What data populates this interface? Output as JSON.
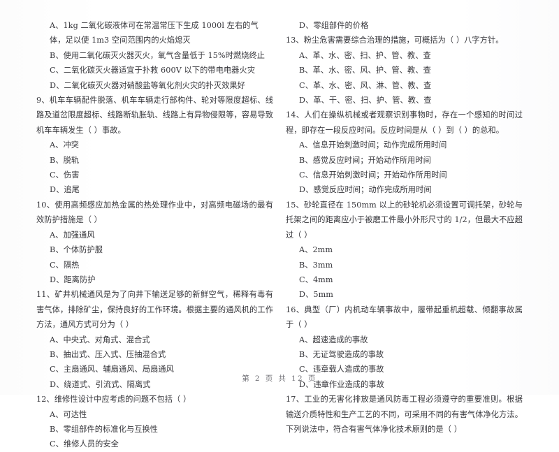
{
  "document": {
    "type": "scanned-exam-paper",
    "page_footer": "第 2 页 共 12 页",
    "ink_color": "#35353a",
    "paper_color": "#ffffff"
  },
  "left_column": {
    "continued_options": [
      "A、1kg 二氧化碳液体可在常温常压下生成 1000l 左右的气体，足以使 1m3 空间范围内的火焰熄灭",
      "B、使用二氧化碳灭火器灭火，氧气含量低于 15%时燃烧终止",
      "C、二氧化碳灭火器适宜于扑救 600V 以下的带电电器火灾",
      "D、二氧化碳灭火器对硝酸盐等氧化剂火灾的扑灭效果好"
    ],
    "questions": [
      {
        "number": "9",
        "stem": "9、机车车辆配件脱落、机车车辆走行部构件、轮对等限度超标、线路及道岔限度超标、线路断轨胀轨、线路上有异物侵限等，容易导致机车车辆发生（      ）事故。",
        "options": [
          "A、冲突",
          "B、脱轨",
          "C、伤害",
          "D、追尾"
        ]
      },
      {
        "number": "10",
        "stem": "10、使用高频感应加热金属的热处理作业中，对高频电磁场的最有效防护措施是（      ）",
        "options": [
          "A、加强通风",
          "B、个体防护服",
          "C、隔热",
          "D、距离防护"
        ]
      },
      {
        "number": "11",
        "stem": "11、矿井机械通风是为了向井下输送足够的新鲜空气，稀释有毒有害气体，排除矿尘，保持良好的工作环境。根据主要的通风机的工作方法，通风方式可分为（      ）",
        "options": [
          "A、中央式、对角式、混合式",
          "B、抽出式、压入式、压抽混合式",
          "C、主扇通风、辅扇通风、局扇通风",
          "D、绕道式、引流式、隔离式"
        ]
      },
      {
        "number": "12",
        "stem": "12、维修性设计中应考虑的问题不包括（      ）",
        "options": [
          "A、可达性",
          "B、零组部件的标准化与互换性",
          "C、维修人员的安全"
        ]
      }
    ]
  },
  "right_column": {
    "continued_options": [
      "D、零组部件的价格"
    ],
    "questions": [
      {
        "number": "13",
        "stem": "13、粉尘危害需要综合治理的措施，可概括为（      ）八字方针。",
        "options": [
          "A、革、水、密、扫、护、管、教、查",
          "B、革、水、密、风、护、管、教、查",
          "C、革、水、密、风、淋、管、教、查",
          "D、革、干、密、扫、护、管、教、查"
        ]
      },
      {
        "number": "14",
        "stem": "14、人们在操纵机械或者观察识别事物时，存在一个感知的时间过程，即存在一段反应时间。反应时间是从（      ）到（      ）的总和。",
        "options": [
          "A、信息开始刺激时间；动作完成所用时间",
          "B、感觉反应时间；开始动作所用时间",
          "C、信息开始刺激时间；开始动作所用时间",
          "D、感觉反应时间；动作完成所用时间"
        ]
      },
      {
        "number": "15",
        "stem": "15、砂轮直径在 150mm 以上的砂轮机必须设置可调托架，砂轮与托架之间的距离应小于被磨工件最小外形尺寸的 1/2，但最大不应超过（      ）",
        "options": [
          "A、2mm",
          "B、3mm",
          "C、4mm",
          "D、5mm"
        ]
      },
      {
        "number": "16",
        "stem": "16、典型（厂）内机动车辆事故中，履带起重机超载、倾翻事故属于（      ）",
        "options": [
          "A、超速造成的事故",
          "B、无证驾驶造成的事故",
          "C、违章载人造成的事故",
          "D、违章作业造成的事故"
        ]
      },
      {
        "number": "17",
        "stem": "17、工业的无害化排放是通风防毒工程必须遵守的重要准则。根据输送介质特性和生产工艺的不同，可采用不同的有害气体净化方法。下列说法中，符合有害气体净化技术原则的是（      ）",
        "options": []
      }
    ]
  }
}
